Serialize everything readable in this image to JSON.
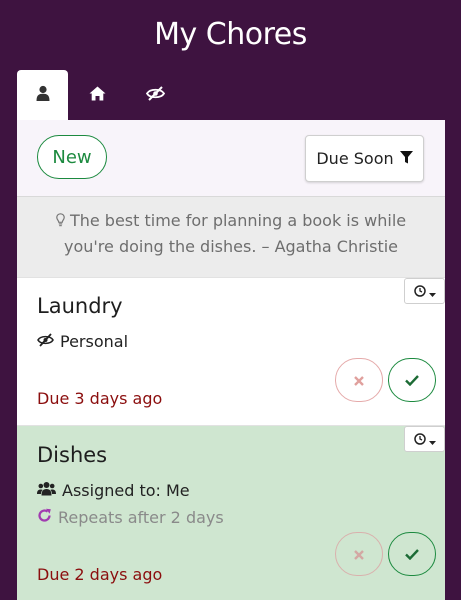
{
  "app": {
    "title": "My Chores"
  },
  "tabs": [
    {
      "icon": "user-icon"
    },
    {
      "icon": "home-icon"
    },
    {
      "icon": "eye-slash-icon"
    }
  ],
  "toolbar": {
    "new_label": "New",
    "sort_label": "Due Soon",
    "sort_icon": "filter-icon"
  },
  "quote": {
    "icon": "lightbulb-icon",
    "text": "The best time for planning a book is while you're doing the dishes. – Agatha Christie"
  },
  "chores": [
    {
      "name": "Laundry",
      "visibility_label": "Personal",
      "visibility_icon": "eye-slash-icon",
      "due": "Due 3 days ago",
      "background": "#ffffff"
    },
    {
      "name": "Dishes",
      "assigned_label": "Assigned to: Me",
      "assigned_icon": "users-icon",
      "repeat_label": "Repeats after 2 days",
      "repeat_icon": "refresh-icon",
      "due": "Due 2 days ago",
      "background": "#cfe6d0"
    }
  ],
  "colors": {
    "header_bg": "#3e1340",
    "accent_green": "#1c8a3f",
    "due_red": "#8b0e0e",
    "repeat_purple": "#a13bb0"
  }
}
